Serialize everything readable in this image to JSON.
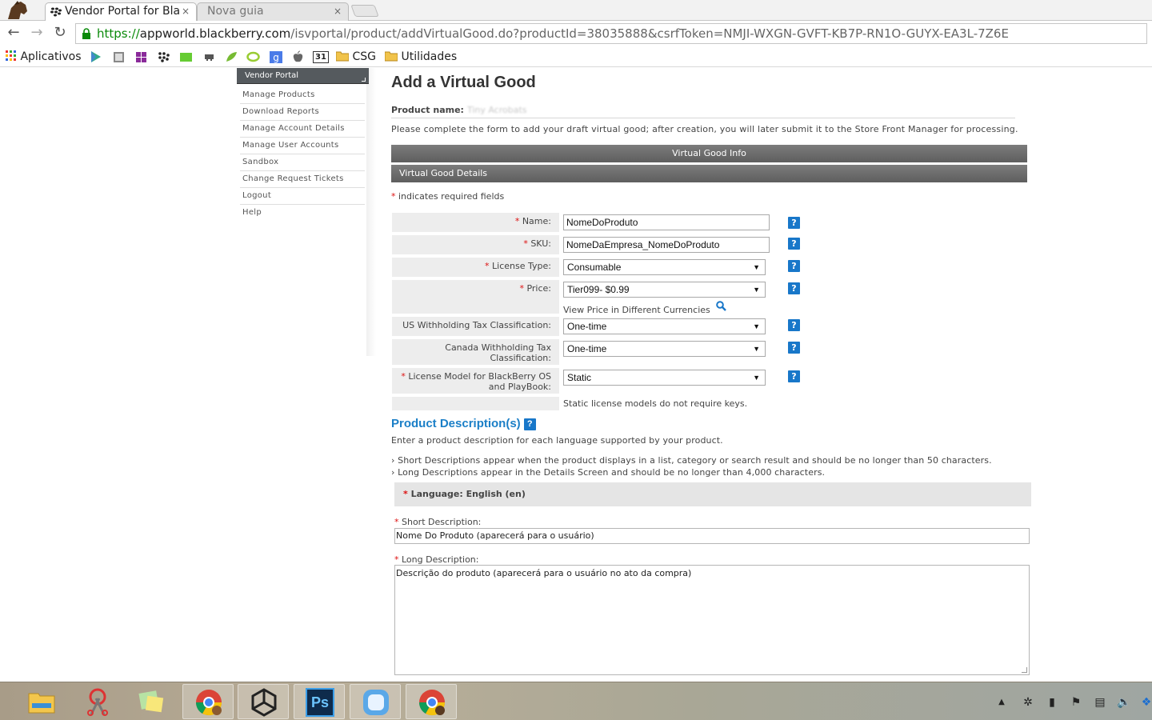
{
  "browser": {
    "tabs": [
      {
        "title": "Vendor Portal for Bla",
        "close": "×",
        "active": true
      },
      {
        "title": "Nova guia",
        "close": "×",
        "active": false
      }
    ],
    "url": {
      "scheme": "https://",
      "host": "appworld.blackberry.com",
      "path": "/isvportal/product/addVirtualGood.do?productId=38035888&csrfToken=NMJI-WXGN-GVFT-KB7P-RN1O-GUYX-EA3L-7Z6E"
    },
    "bookmarks": {
      "apps_label": "Aplicativos",
      "folders": [
        "CSG",
        "Utilidades"
      ],
      "calendar_badge": "31"
    }
  },
  "sidebar": {
    "title": "Vendor Portal",
    "items": [
      {
        "label": "Manage Products"
      },
      {
        "label": "Download Reports"
      },
      {
        "label": "Manage Account Details"
      },
      {
        "label": "Manage User Accounts"
      },
      {
        "label": "Sandbox"
      },
      {
        "label": "Change Request Tickets"
      },
      {
        "label": "Logout"
      },
      {
        "label": "Help"
      }
    ]
  },
  "main": {
    "title": "Add a Virtual Good",
    "product_name_label": "Product name:",
    "product_name_value": "Tiny Acrobats",
    "intro": "Please complete the form to add your draft virtual good; after creation, you will later submit it to the Store Front Manager for processing.",
    "info_band": "Virtual Good Info",
    "details_band": "Virtual Good Details",
    "required_star": "*",
    "required_note": " indicates required fields",
    "help_glyph": "?",
    "form": {
      "name": {
        "label": "Name:",
        "value": "NomeDoProduto"
      },
      "sku": {
        "label": "SKU:",
        "value": "NomeDaEmpresa_NomeDoProduto"
      },
      "license_type": {
        "label": "License Type:",
        "value": "Consumable"
      },
      "price": {
        "label": "Price:",
        "value": "Tier099- $0.99",
        "link": "View Price in Different Currencies"
      },
      "us_tax": {
        "label": "US Withholding Tax Classification:",
        "value": "One-time"
      },
      "ca_tax": {
        "label": "Canada Withholding Tax Classification:",
        "value": "One-time"
      },
      "license_model": {
        "label": "License Model for BlackBerry OS and PlayBook:",
        "value": "Static",
        "note": "Static license models do not require keys."
      }
    },
    "descriptions": {
      "title": "Product Description(s)",
      "intro": "Enter a product description for each language supported by your product.",
      "bullet_short": "Short Descriptions appear when the product displays in a list, category or search result and should be no longer than 50 characters.",
      "bullet_long": "Long Descriptions appear in the Details Screen and should be no longer than 4,000 characters.",
      "language": "Language: English (en)",
      "short_label": "Short Description:",
      "short_value": "Nome Do Produto (aparecerá para o usuário)",
      "long_label": "Long Description:",
      "long_value": "Descrição do produto (aparecerá para o usuário no ato da compra)"
    }
  },
  "taskbar": {
    "apps": [
      "file-explorer",
      "snipping-tool",
      "sticky-notes",
      "chrome",
      "unity",
      "photoshop",
      "finder-app",
      "chrome"
    ],
    "photoshop_label": "Ps"
  }
}
